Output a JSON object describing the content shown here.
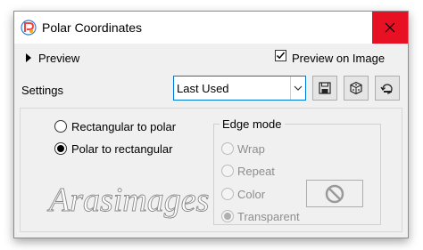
{
  "window": {
    "title": "Polar Coordinates"
  },
  "preview": {
    "label": "Preview"
  },
  "preview_on_image": {
    "label": "Preview on Image",
    "checked": true
  },
  "settings": {
    "label": "Settings",
    "preset": "Last Used"
  },
  "mode": {
    "options": [
      {
        "label": "Rectangular to polar",
        "selected": false
      },
      {
        "label": "Polar to rectangular",
        "selected": true
      }
    ]
  },
  "edge_mode": {
    "title": "Edge mode",
    "options": [
      {
        "label": "Wrap",
        "selected": false
      },
      {
        "label": "Repeat",
        "selected": false
      },
      {
        "label": "Color",
        "selected": false
      },
      {
        "label": "Transparent",
        "selected": true
      }
    ]
  },
  "colors": {
    "close": "#e81123",
    "accent": "#0078d7"
  },
  "watermark": "Arasimages"
}
